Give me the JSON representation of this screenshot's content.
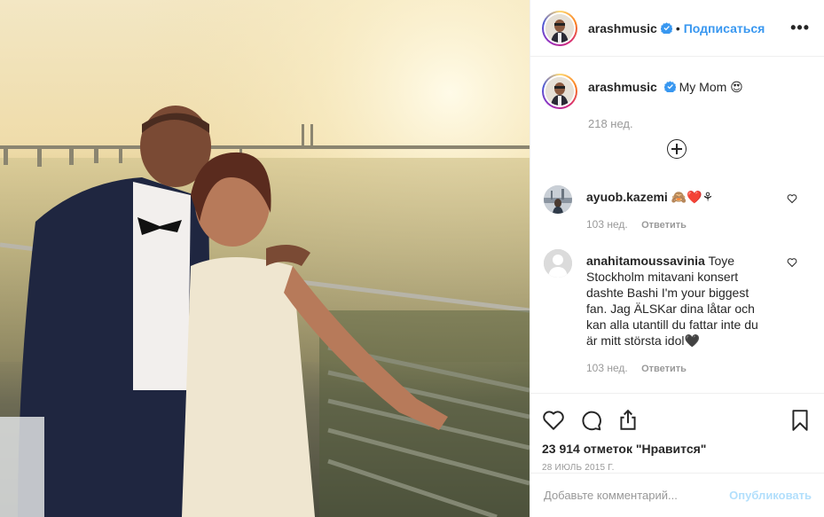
{
  "post": {
    "author": "arashmusic",
    "follow_label": "Подписаться",
    "separator": "•",
    "more_label": "•••",
    "caption_text": "My Mom 😍",
    "caption_time": "218 нед.",
    "likes_text": "23 914 отметок \"Нравится\"",
    "date_text": "28 июль 2015 г.",
    "comment_placeholder": "Добавьте комментарий...",
    "publish_label": "Опубликовать"
  },
  "comments": [
    {
      "user": "ayuob.kazemi",
      "text": "🙈❤️⚘",
      "time": "103 нед.",
      "reply_label": "Ответить"
    },
    {
      "user": "anahitamoussavinia",
      "text": "Toye Stockholm mitavani konsert dashte Bashi I'm your biggest fan. Jag ÄLSKar dina låtar och kan alla utantill du fattar inte du är mitt största idol🖤",
      "time": "103 нед.",
      "reply_label": "Ответить"
    }
  ],
  "colors": {
    "link": "#3897f0",
    "publish_disabled": "#b2dffc",
    "muted": "#999999"
  },
  "icons": [
    "heart-icon",
    "comment-icon",
    "share-icon",
    "bookmark-icon",
    "verified-badge-icon",
    "plus-circle-icon",
    "more-options-icon"
  ]
}
